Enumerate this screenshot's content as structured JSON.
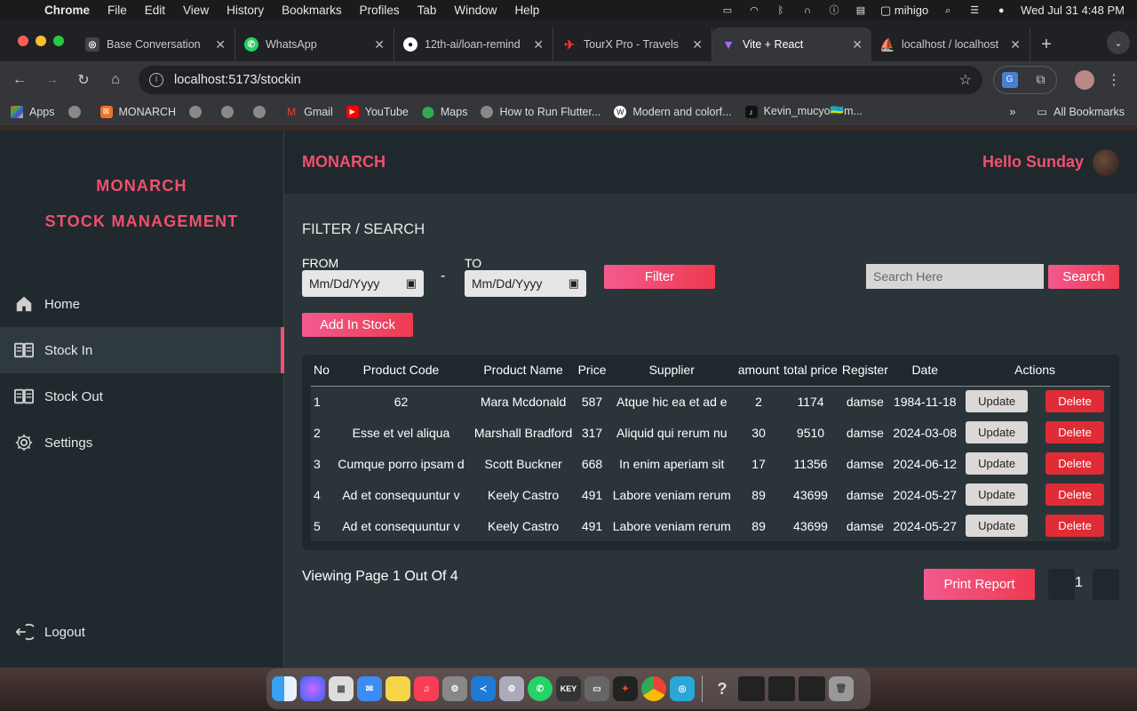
{
  "menubar": {
    "app": "Chrome",
    "items": [
      "File",
      "Edit",
      "View",
      "History",
      "Bookmarks",
      "Profiles",
      "Tab",
      "Window",
      "Help"
    ],
    "user": "mihigo",
    "datetime": "Wed Jul 31  4:48 PM"
  },
  "tabs": [
    {
      "title": "Base Conversation",
      "icon_color": "#444"
    },
    {
      "title": "WhatsApp",
      "icon_color": "#25d366"
    },
    {
      "title": "12th-ai/loan-remind",
      "icon_color": "#111"
    },
    {
      "title": "TourX Pro - Travels",
      "icon_color": "#e33"
    },
    {
      "title": "Vite + React",
      "icon_color": "#9b6cff"
    },
    {
      "title": "localhost / localhost",
      "icon_color": "#e8902a"
    }
  ],
  "address": {
    "url": "localhost:5173/stockin"
  },
  "bookmarks": {
    "items": [
      "Apps",
      "",
      "MONARCH",
      "",
      "",
      "",
      "Gmail",
      "YouTube",
      "Maps",
      "How to Run Flutter...",
      "Modern and colorf...",
      "Kevin_mucyo🇷🇼m..."
    ],
    "all": "All Bookmarks",
    "more": "»"
  },
  "sidebar": {
    "brand_line1": "MONARCH",
    "brand_line2": "STOCK MANAGEMENT",
    "items": [
      {
        "label": "Home"
      },
      {
        "label": "Stock In"
      },
      {
        "label": "Stock Out"
      },
      {
        "label": "Settings"
      }
    ],
    "logout": "Logout"
  },
  "header": {
    "title": "MONARCH",
    "greeting": "Hello Sunday"
  },
  "filter": {
    "title": "FILTER / SEARCH",
    "from_label": "FROM",
    "to_label": "TO",
    "date_placeholder": "Mm/Dd/Yyyy",
    "separator": "-",
    "filter_button": "Filter",
    "search_placeholder": "Search Here",
    "search_button": "Search",
    "add_button": "Add In Stock"
  },
  "table": {
    "headers": [
      "No",
      "Product Code",
      "Product Name",
      "Price",
      "Supplier",
      "amount",
      "total price",
      "Register",
      "Date",
      "Actions"
    ],
    "update_label": "Update",
    "delete_label": "Delete",
    "rows": [
      [
        "1",
        "62",
        "Mara Mcdonald",
        "587",
        "Atque hic ea et ad e",
        "2",
        "1174",
        "damse",
        "1984-11-18"
      ],
      [
        "2",
        "Esse et vel aliqua",
        "Marshall Bradford",
        "317",
        "Aliquid qui rerum nu",
        "30",
        "9510",
        "damse",
        "2024-03-08"
      ],
      [
        "3",
        "Cumque porro ipsam d",
        "Scott Buckner",
        "668",
        "In enim aperiam sit",
        "17",
        "11356",
        "damse",
        "2024-06-12"
      ],
      [
        "4",
        "Ad et consequuntur v",
        "Keely Castro",
        "491",
        "Labore veniam rerum",
        "89",
        "43699",
        "damse",
        "2024-05-27"
      ],
      [
        "5",
        "Ad et consequuntur v",
        "Keely Castro",
        "491",
        "Labore veniam rerum",
        "89",
        "43699",
        "damse",
        "2024-05-27"
      ]
    ]
  },
  "pagination": {
    "info": "Viewing Page 1 Out Of 4",
    "print_button": "Print Report",
    "current": "1"
  },
  "colors": {
    "accent": "#f0506e",
    "delete": "#e02c36",
    "sidebar": "#1f292e",
    "main": "#2b3539"
  }
}
